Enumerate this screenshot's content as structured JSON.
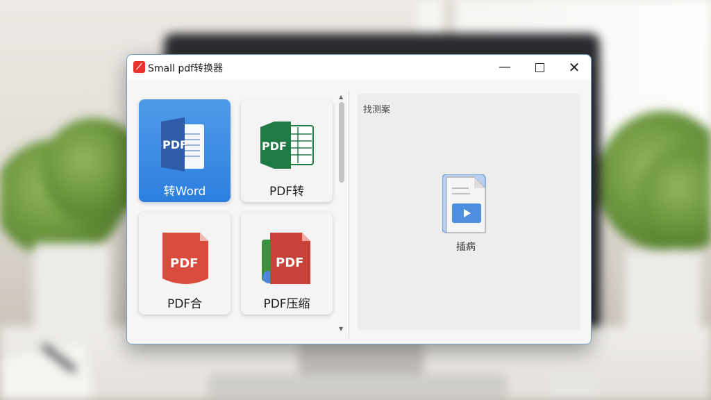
{
  "window": {
    "title": "Small pdf转换器",
    "app_icon_glyph": "⟋"
  },
  "controls": {
    "minimize_glyph": "—",
    "close_glyph": "✕"
  },
  "tiles": [
    {
      "label": "转Word",
      "icon": "pdf-to-word-icon",
      "icon_text": "PDF",
      "selected": true
    },
    {
      "label": "PDF转",
      "icon": "pdf-to-excel-icon",
      "icon_text": "PDF",
      "selected": false
    },
    {
      "label": "PDF合",
      "icon": "pdf-merge-icon",
      "icon_text": "PDF",
      "selected": false
    },
    {
      "label": "PDF压缩",
      "icon": "pdf-compress-icon",
      "icon_text": "PDF",
      "selected": false
    }
  ],
  "scrollbar": {
    "up_glyph": "▲",
    "down_glyph": "▼"
  },
  "preview": {
    "title": "找测案",
    "file_label": "插病"
  },
  "colors": {
    "accent": "#2c7fde",
    "word_blue": "#2f5ca8",
    "excel_green": "#1f7a43",
    "pdf_red": "#d94c3d"
  }
}
